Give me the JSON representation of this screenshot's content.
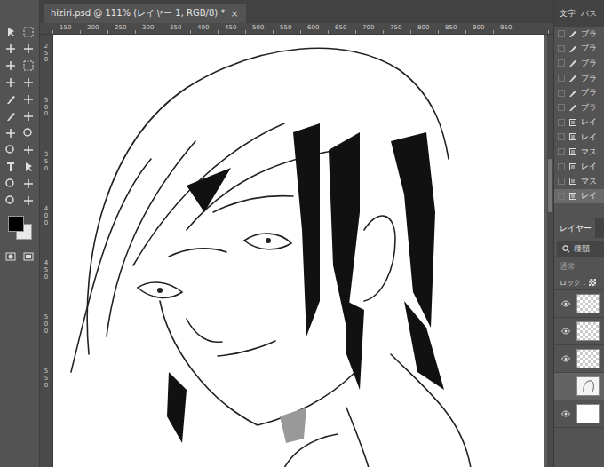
{
  "window": {
    "title": "hiziri.psd @ 111% (レイヤー 1, RGB/8) *",
    "close": "×"
  },
  "ruler": {
    "top": [
      "150",
      "200",
      "250",
      "300",
      "350",
      "400",
      "450",
      "500",
      "550",
      "600",
      "650",
      "700",
      "750",
      "800",
      "850",
      "900",
      "950"
    ],
    "left": [
      "250",
      "300",
      "350",
      "400",
      "450",
      "500",
      "550"
    ]
  },
  "panel_tabs": [
    {
      "label": "文字",
      "selected": false
    },
    {
      "label": "パス",
      "selected": false
    }
  ],
  "history": [
    {
      "label": "ブラ",
      "kind": "brush",
      "selected": false
    },
    {
      "label": "ブラ",
      "kind": "brush",
      "selected": false
    },
    {
      "label": "ブラ",
      "kind": "brush",
      "selected": false
    },
    {
      "label": "ブラ",
      "kind": "brush",
      "selected": false
    },
    {
      "label": "ブラ",
      "kind": "brush",
      "selected": false
    },
    {
      "label": "ブラ",
      "kind": "brush",
      "selected": false
    },
    {
      "label": "レイ",
      "kind": "layer",
      "selected": false
    },
    {
      "label": "レイ",
      "kind": "layer",
      "selected": false
    },
    {
      "label": "マス",
      "kind": "layer",
      "selected": false
    },
    {
      "label": "レイ",
      "kind": "layer",
      "selected": false
    },
    {
      "label": "マス",
      "kind": "layer",
      "selected": false
    },
    {
      "label": "レイ",
      "kind": "layer",
      "selected": true
    }
  ],
  "layers_panel": {
    "title": "レイヤー",
    "search": "種類",
    "blend": "通常",
    "lock": "ロック :",
    "layers": [
      {
        "visible": true,
        "kind": "transparent",
        "selected": false
      },
      {
        "visible": true,
        "kind": "transparent",
        "selected": false
      },
      {
        "visible": true,
        "kind": "transparent",
        "selected": false
      },
      {
        "visible": false,
        "kind": "sketch",
        "selected": true
      },
      {
        "visible": true,
        "kind": "white",
        "selected": false
      }
    ]
  }
}
